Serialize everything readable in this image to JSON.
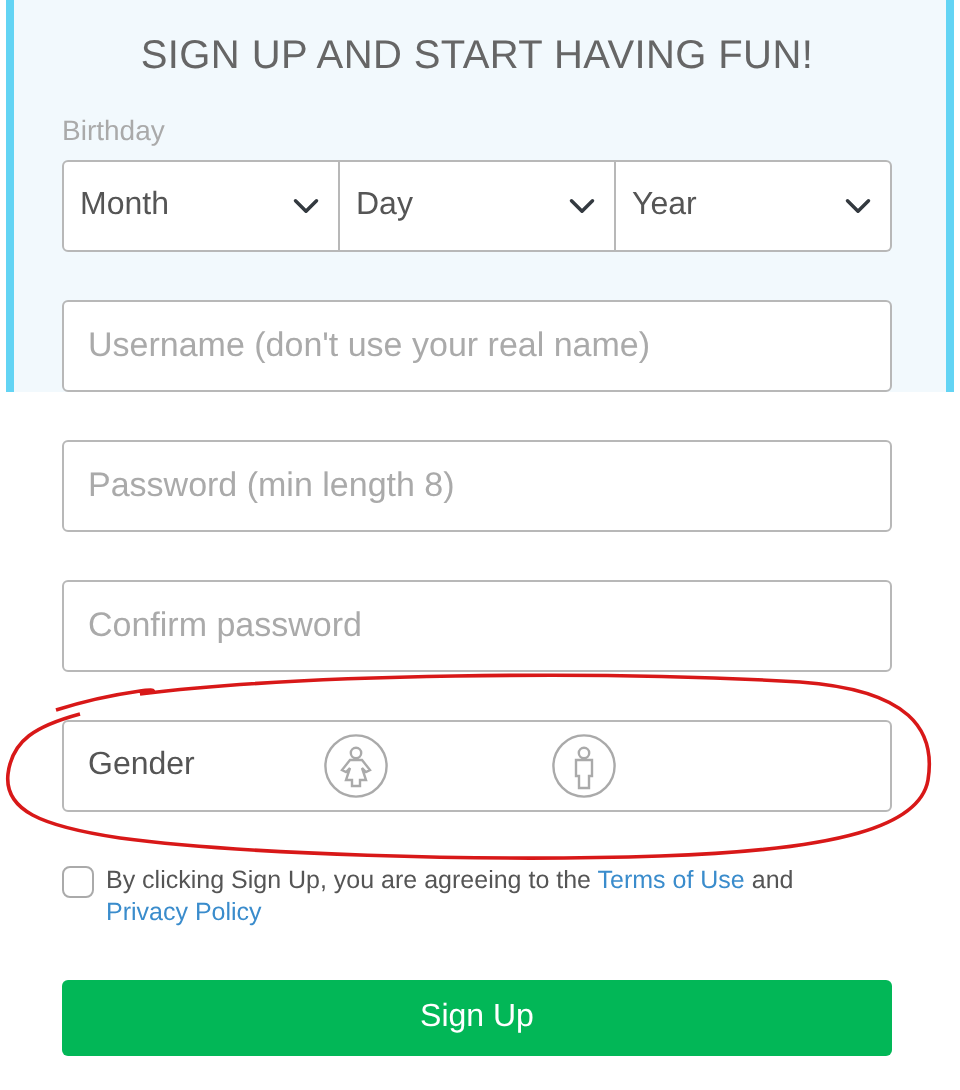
{
  "heading": "SIGN UP AND START HAVING FUN!",
  "birthday": {
    "label": "Birthday",
    "selects": [
      {
        "value": "Month"
      },
      {
        "value": "Day"
      },
      {
        "value": "Year"
      }
    ]
  },
  "fields": [
    {
      "placeholder": "Username (don't use your real name)"
    },
    {
      "placeholder": "Password (min length 8)"
    },
    {
      "placeholder": "Confirm password"
    }
  ],
  "gender": {
    "label": "Gender",
    "options": [
      {
        "kind": "female"
      },
      {
        "kind": "male"
      }
    ]
  },
  "agreement": {
    "checked": false,
    "segments": [
      {
        "kind": "text",
        "text": "By clicking Sign Up, you are agreeing to the "
      },
      {
        "kind": "link",
        "text": "Terms of Use"
      },
      {
        "kind": "text",
        "text": " and "
      },
      {
        "kind": "link",
        "text": "Privacy Policy"
      }
    ]
  },
  "submit": "Sign Up",
  "annotation": {
    "kind": "freehand-ellipse"
  }
}
